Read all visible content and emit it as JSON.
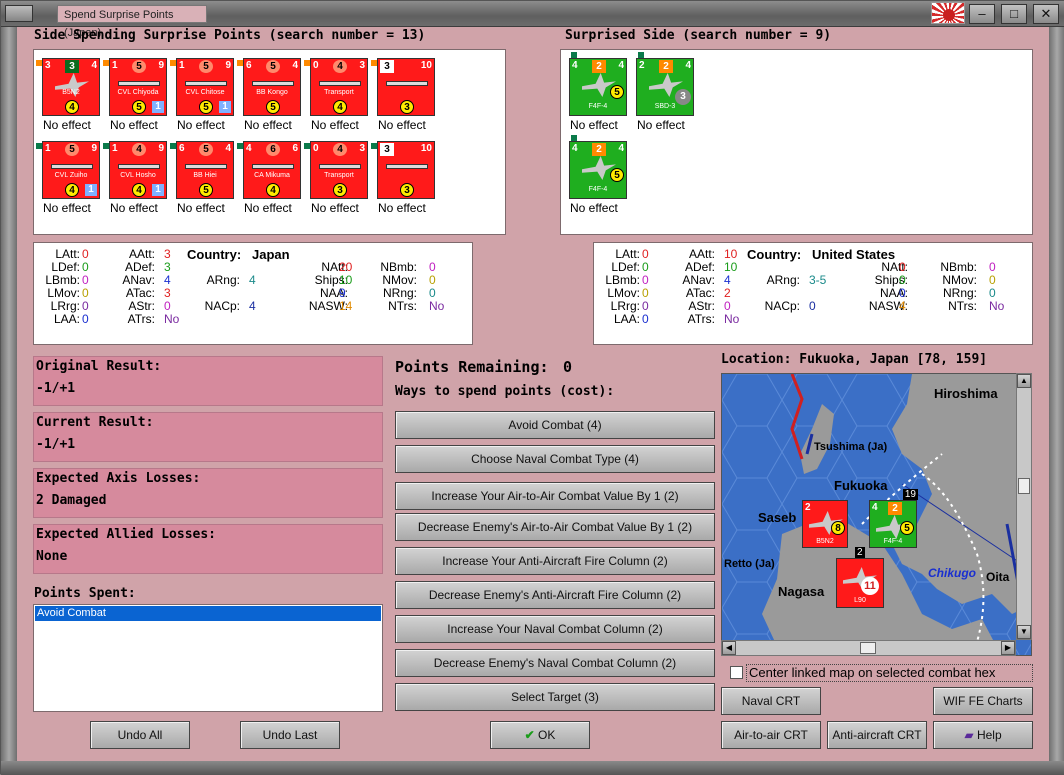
{
  "window": {
    "title": "Spend Surprise Points (Japan)."
  },
  "left_header": "Side Spending Surprise Points (search number = 13)",
  "right_header": "Surprised Side (search number = 9)",
  "left_units": [
    {
      "tl": "3",
      "top": "3",
      "tr": "4",
      "name": "B5N2",
      "y1": "4",
      "blue": "",
      "effect": "No effect",
      "kind": "plane",
      "topstyle": "gr"
    },
    {
      "tl": "1",
      "top": "5",
      "tr": "9",
      "name": "CVL Chiyoda",
      "y1": "5",
      "blue": "1",
      "effect": "No effect",
      "kind": "ship"
    },
    {
      "tl": "1",
      "top": "5",
      "tr": "9",
      "name": "CVL Chitose",
      "y1": "5",
      "blue": "1",
      "effect": "No effect",
      "kind": "ship"
    },
    {
      "tl": "6",
      "top": "5",
      "tr": "4",
      "name": "BB Kongo",
      "y1": "5",
      "blue": "",
      "effect": "No effect",
      "kind": "ship"
    },
    {
      "tl": "0",
      "top": "4",
      "tr": "3",
      "name": "Transport",
      "y1": "4",
      "blue": "",
      "effect": "No effect",
      "kind": "ship"
    },
    {
      "tl": "1",
      "top": "3",
      "tr": "10",
      "name": "",
      "y1": "3",
      "blue": "",
      "effect": "No effect",
      "kind": "ship",
      "topstyle": "wh"
    },
    {
      "tl": "1",
      "top": "5",
      "tr": "9",
      "name": "CVL Zuiho",
      "y1": "4",
      "blue": "1",
      "effect": "No effect",
      "kind": "ship"
    },
    {
      "tl": "1",
      "top": "4",
      "tr": "9",
      "name": "CVL Hosho",
      "y1": "4",
      "blue": "1",
      "effect": "No effect",
      "kind": "ship"
    },
    {
      "tl": "6",
      "top": "5",
      "tr": "4",
      "name": "BB Hiei",
      "y1": "5",
      "blue": "",
      "effect": "No effect",
      "kind": "ship"
    },
    {
      "tl": "4",
      "top": "6",
      "tr": "6",
      "name": "CA Mikuma",
      "y1": "4",
      "blue": "",
      "effect": "No effect",
      "kind": "ship"
    },
    {
      "tl": "0",
      "top": "4",
      "tr": "3",
      "name": "Transport",
      "y1": "3",
      "blue": "",
      "effect": "No effect",
      "kind": "ship"
    },
    {
      "tl": "1",
      "top": "3",
      "tr": "10",
      "name": "",
      "y1": "3",
      "blue": "",
      "effect": "No effect",
      "kind": "ship",
      "topstyle": "wh"
    }
  ],
  "right_units": [
    {
      "tl": "4",
      "top": "2",
      "tr": "4",
      "name": "F4F-4",
      "y1": "5",
      "effect": "No effect"
    },
    {
      "tl": "2",
      "top": "2",
      "tr": "4",
      "name": "SBD-3",
      "y1": "",
      "grey": "3",
      "effect": "No effect"
    },
    {
      "tl": "4",
      "top": "2",
      "tr": "4",
      "name": "F4F-4",
      "y1": "5",
      "effect": "No effect"
    }
  ],
  "left_stats": {
    "country_label": "Country:",
    "country": "Japan",
    "LAtt": "0",
    "LDef": "0",
    "LBmb": "0",
    "LMov": "0",
    "LRrg": "0",
    "LAA": "0",
    "AAtt": "3",
    "ADef": "3",
    "ANav": "4",
    "ATac": "3",
    "AStr": "0",
    "ATrs": "No",
    "ARng": "4",
    "NACp": "4",
    "NAtt": "20",
    "Ships": "10",
    "NAA": "9",
    "NASW": "14",
    "NBmb": "0",
    "NMov": "0",
    "NRng": "0",
    "NTrs": "No"
  },
  "right_stats": {
    "country_label": "Country:",
    "country": "United States",
    "LAtt": "0",
    "LDef": "0",
    "LBmb": "0",
    "LMov": "0",
    "LRrg": "0",
    "LAA": "0",
    "AAtt": "10",
    "ADef": "10",
    "ANav": "4",
    "ATac": "2",
    "AStr": "0",
    "ATrs": "No",
    "ARng": "3-5",
    "NACp": "0",
    "NAtt": "0",
    "Ships": "0",
    "NAA": "0",
    "NASW": "4",
    "NBmb": "0",
    "NMov": "0",
    "NRng": "0",
    "NTrs": "No"
  },
  "results": [
    {
      "label": "Original Result:",
      "value": "-1/+1"
    },
    {
      "label": "Current Result:",
      "value": "-1/+1"
    },
    {
      "label": "Expected Axis Losses:",
      "value": "2 Damaged"
    },
    {
      "label": "Expected Allied Losses:",
      "value": "None"
    }
  ],
  "points_spent": {
    "label": "Points Spent:",
    "items": [
      "Avoid Combat"
    ]
  },
  "points_remaining": {
    "label": "Points Remaining:",
    "value": "0"
  },
  "ways_label": "Ways to spend points (cost):",
  "spend_options": [
    "Avoid Combat (4)",
    "Choose Naval Combat Type (4)",
    "Increase Your Air-to-Air Combat Value By 1 (2)",
    "Decrease Enemy's Air-to-Air Combat Value By 1 (2)",
    "Increase Your Anti-Aircraft Fire Column (2)",
    "Decrease Enemy's Anti-Aircraft Fire Column (2)",
    "Increase Your Naval Combat Column (2)",
    "Decrease Enemy's Naval Combat Column (2)",
    "Select Target (3)"
  ],
  "bottom_buttons": {
    "undo_all": "Undo All",
    "undo_last": "Undo Last",
    "ok": "OK"
  },
  "map": {
    "location": "Location: Fukuoka, Japan [78, 159]",
    "labels": {
      "hiroshima": "Hiroshima",
      "tsushima": "Tsushima (Ja)",
      "fukuoka": "Fukuoka",
      "sasebo": "Saseb",
      "retto": "Retto (Ja)",
      "nagasa": "Nagasa",
      "chikugo": "Chikugo",
      "oita": "Oita"
    },
    "units": {
      "b5n2_name": "B5N2",
      "b5n2_tl": "2",
      "b5n2_val": "8",
      "f4f_name": "F4F-4",
      "f4f_tl": "4",
      "f4f_top": "2",
      "f4f_val": "5",
      "f4f_stack": "19",
      "l90_name": "L90",
      "l90_val": "11",
      "l90_tag": "2"
    },
    "center_checkbox_label": "Center linked map on selected combat hex",
    "center_checked": false
  },
  "right_buttons": {
    "naval_crt": "Naval CRT",
    "wif_fe": "WIF FE Charts",
    "air_crt": "Air-to-air CRT",
    "aa_crt": "Anti-aircraft CRT",
    "help": "Help"
  },
  "colors": {
    "background": "#d0a3a9",
    "pink_panel": "#d68a9d",
    "japan_red": "#ff1a1a",
    "us_green": "#1fae1f",
    "sea": "#3b6fc6",
    "land": "#9a9a9a"
  }
}
